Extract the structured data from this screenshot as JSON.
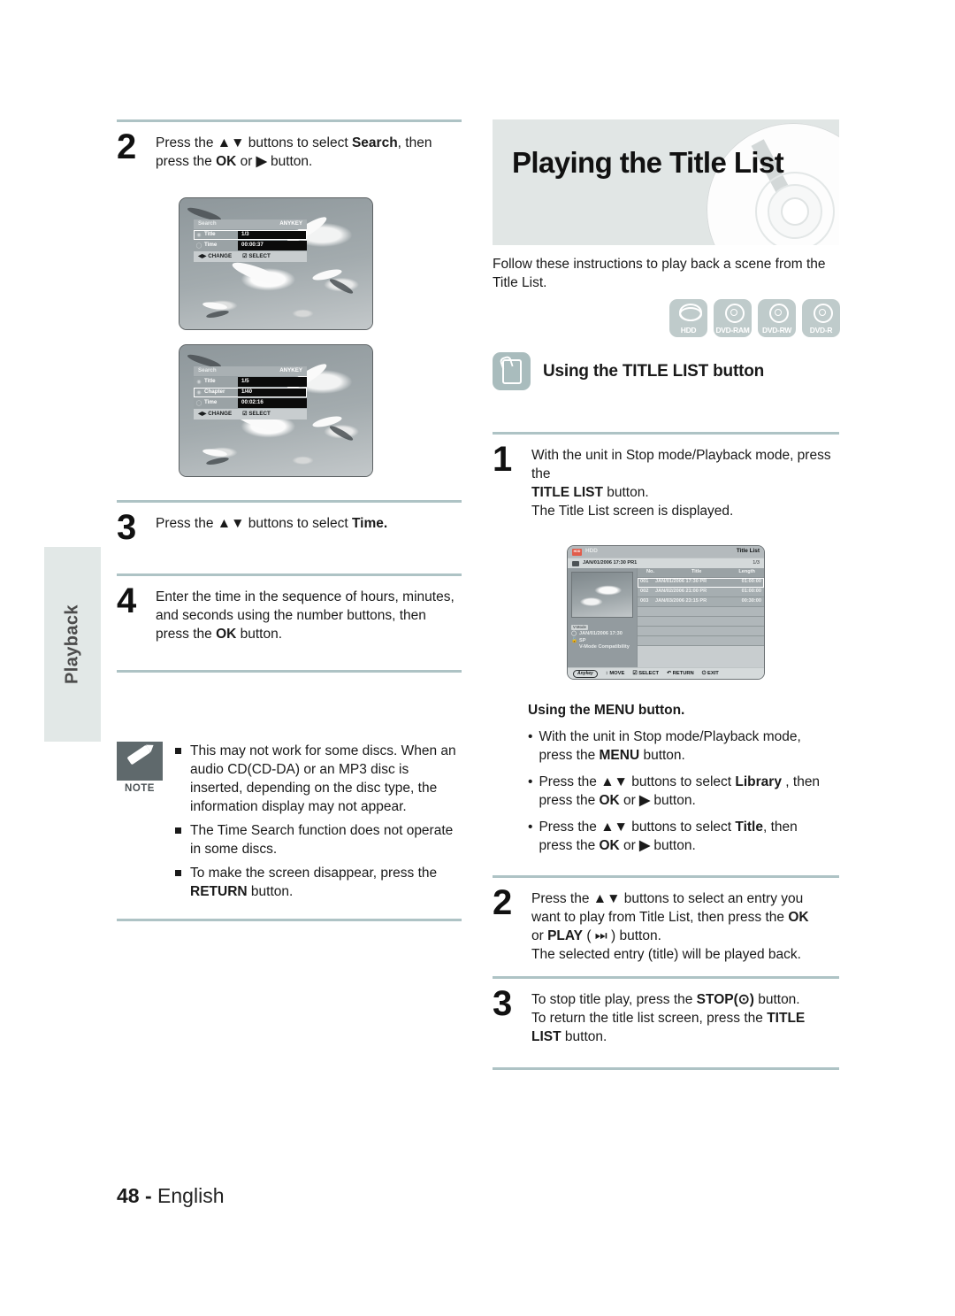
{
  "page": {
    "number": "48",
    "separator": "-",
    "language": "English"
  },
  "side_tab": {
    "label": "Playback"
  },
  "left_column": {
    "steps": [
      {
        "number": "2",
        "line1_a": "Press the ",
        "line1_arrows": "▲▼",
        "line1_b": " buttons to select ",
        "line1_bold": "Search",
        "line1_c": ", then",
        "line2_a": "press the ",
        "line2_bold": "OK",
        "line2_b": " or ",
        "line2_arrow": "▶",
        "line2_c": " button."
      },
      {
        "number": "3",
        "line1_a": "Press the ",
        "line1_arrows": "▲▼",
        "line1_b": " buttons to select ",
        "line1_bold": "Time.",
        "line1_c": ""
      },
      {
        "number": "4",
        "line1": "Enter the time in the sequence of hours, minutes,",
        "line2": "and seconds using the number buttons, then",
        "line3_a": "press the ",
        "line3_bold": "OK",
        "line3_b": " button."
      }
    ],
    "osd_screens": [
      {
        "title": "Search",
        "anykey": "ANYKEY",
        "rows": [
          {
            "icon": "disc-icon",
            "name": "Title",
            "value": "1/3",
            "selected": true
          },
          {
            "icon": "clock-icon",
            "name": "Time",
            "value": "00:00:37",
            "selected": false
          }
        ],
        "footer": [
          {
            "glyph": "◀▶",
            "label": "CHANGE"
          },
          {
            "glyph": "☑",
            "label": "SELECT"
          }
        ]
      },
      {
        "title": "Search",
        "anykey": "ANYKEY",
        "rows": [
          {
            "icon": "disc-icon",
            "name": "Title",
            "value": "1/5",
            "selected": false
          },
          {
            "icon": "chapter-icon",
            "name": "Chapter",
            "value": "1/40",
            "selected": true
          },
          {
            "icon": "clock-icon",
            "name": "Time",
            "value": "00:02:16",
            "selected": false
          }
        ],
        "footer": [
          {
            "glyph": "◀▶",
            "label": "CHANGE"
          },
          {
            "glyph": "☑",
            "label": "SELECT"
          }
        ]
      }
    ]
  },
  "note": {
    "tag_label": "NOTE",
    "items": [
      "This may not work for some discs. When an audio CD(CD-DA) or an MP3 disc is inserted, depending on the disc type, the information display may not appear.",
      "The Time Search function does not operate in some discs.",
      "To make the screen disappear, press the RETURN button."
    ],
    "item3_prefix": "To make the screen disappear, press the",
    "item3_bold": "RETURN",
    "item3_suffix": " button."
  },
  "right_column": {
    "banner_title": "Playing the Title List",
    "intro": "Follow these instructions to play back a scene from the Title List.",
    "media_badges": [
      {
        "label": "HDD",
        "glyph": "hdd-stack-icon"
      },
      {
        "label": "DVD-RAM",
        "glyph": "disc-icon"
      },
      {
        "label": "DVD-RW",
        "glyph": "disc-icon"
      },
      {
        "label": "DVD-R",
        "glyph": "disc-icon"
      }
    ],
    "section_heading": "Using the TITLE LIST button",
    "section_icon": "press-button-icon",
    "step1": {
      "number": "1",
      "line1": "With the unit in Stop mode/Playback mode, press the",
      "line2_bold": "TITLE LIST",
      "line2_rest": " button.",
      "line3": "The Title List screen is displayed."
    },
    "title_list_screen": {
      "source_chip": "HDD",
      "source_label": "HDD",
      "screen_title": "Title List",
      "subtitle": "JAN/01/2006 17:30 PR1",
      "page_indicator": "1/3",
      "columns": {
        "no": "No.",
        "title": "Title",
        "length": "Length"
      },
      "rows": [
        {
          "no": "001",
          "title": "JAN/01/2006 17:30 PR",
          "length": "01:00:00",
          "selected": true
        },
        {
          "no": "002",
          "title": "JAN/02/2006 21:00 PR",
          "length": "01:00:00",
          "selected": false
        },
        {
          "no": "003",
          "title": "JAN/03/2006 23:15 PR",
          "length": "00:30:00",
          "selected": false
        }
      ],
      "blank_rows": 4,
      "info_panel": {
        "chip": "V-Mode",
        "date": "JAN/01/2006 17:30",
        "mode": "SP",
        "compat": "V-Mode Compatibility"
      },
      "footer": [
        {
          "glyph": "Anykey",
          "label": ""
        },
        {
          "glyph": "↕",
          "label": "MOVE"
        },
        {
          "glyph": "☑",
          "label": "SELECT"
        },
        {
          "glyph": "↶",
          "label": "RETURN"
        },
        {
          "glyph": "⏻",
          "label": "EXIT"
        }
      ]
    },
    "menu_section": {
      "heading": "Using the MENU button.",
      "bullets": [
        {
          "l1_a": "With the unit in Stop mode/Playback mode,",
          "l2_a": "press the ",
          "l2_bold": "MENU",
          "l2_b": " button."
        },
        {
          "l1_a": "Press the ",
          "l1_arrows": "▲▼",
          "l1_b": " buttons to select ",
          "l1_bold": "Library",
          "l1_c": " , then",
          "l2_a": "press the ",
          "l2_bold": "OK",
          "l2_b": " or ",
          "l2_arrow": "▶",
          "l2_c": " button."
        },
        {
          "l1_a": "Press the ",
          "l1_arrows": "▲▼",
          "l1_b": " buttons to select ",
          "l1_bold": "Title",
          "l1_c": ", then",
          "l2_a": "press the ",
          "l2_bold": "OK",
          "l2_b": " or ",
          "l2_arrow": "▶",
          "l2_c": " button."
        }
      ]
    },
    "step2": {
      "number": "2",
      "l1": "Press the ",
      "l1_arrows": "▲▼",
      "l1_b": " buttons to select an entry you",
      "l2_a": "want to play from Title List, then press the ",
      "l2_bold": "OK",
      "l3_a": "or ",
      "l3_bold": "PLAY",
      "l3_b": " ( ⏭ ) button.",
      "l4": "The selected entry (title) will be played back."
    },
    "step3": {
      "number": "3",
      "l1_a": "To stop title play, press the ",
      "l1_bold": "STOP(⊙)",
      "l1_b": " button.",
      "l2_a": "To return the title list screen, press the ",
      "l2_bold": "TITLE",
      "l3_bold": "LIST",
      "l3_b": " button."
    }
  },
  "colors": {
    "rule": "#aec3c5",
    "banner_bg": "#e1e6e5",
    "badge_bg": "#bfcbcb",
    "note_tag": "#5f696c",
    "side_tab": "#e2e8e7"
  }
}
